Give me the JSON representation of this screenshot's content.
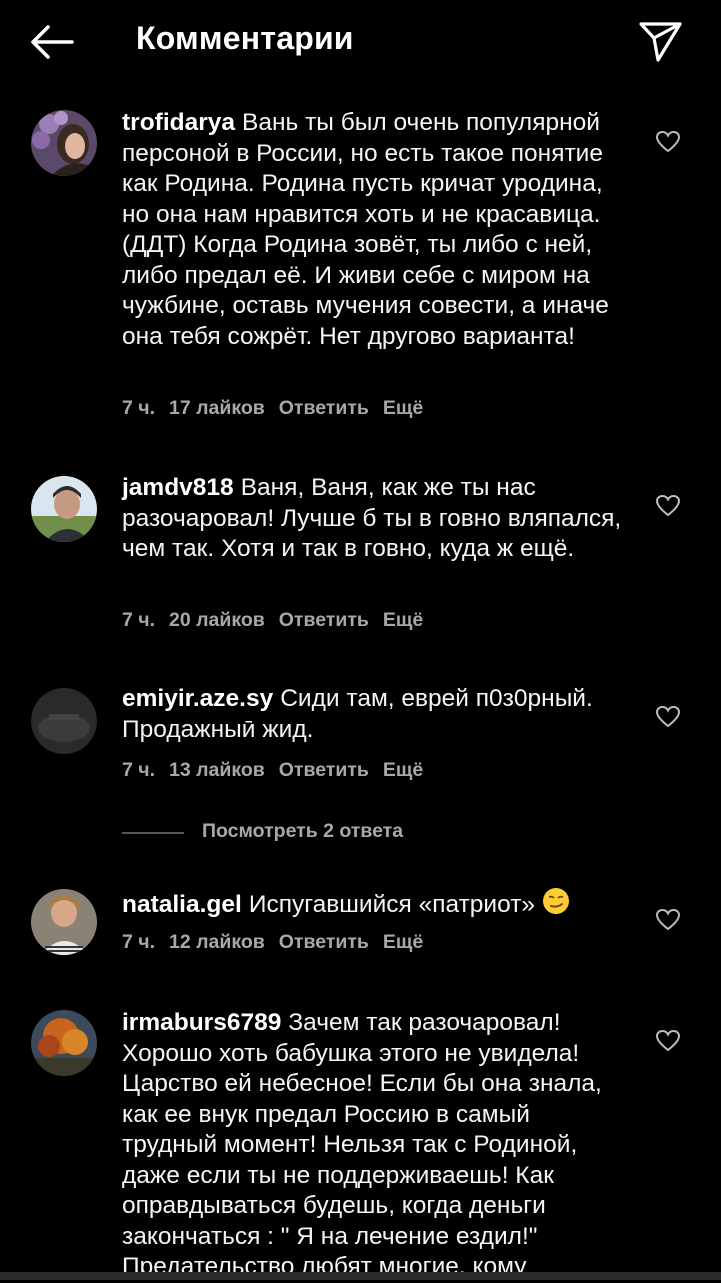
{
  "header": {
    "title": "Комментарии"
  },
  "comments": [
    {
      "username": "trofidarya",
      "text": "Вань ты был очень популярной персоной в России, но есть такое понятие как Родина. Родина пусть кричат уродина, но она нам нравится хоть и не красавица. (ДДТ) Когда Родина зовёт, ты либо с ней, либо предал её. И живи себе с миром на чужбине, оставь мучения совести, а иначе она тебя сожрёт. Нет другово варианта!",
      "time": "7 ч.",
      "likes": "17 лайков",
      "reply": "Ответить",
      "more": "Ещё"
    },
    {
      "username": "jamdv818",
      "text": "Ваня, Ваня, как же ты нас разочаровал! Лучше б ты в говно вляпался, чем так. Хотя и так в говно, куда ж ещё.",
      "time": "7 ч.",
      "likes": "20 лайков",
      "reply": "Ответить",
      "more": "Ещё"
    },
    {
      "username": "emiyir.aze.sy",
      "text": "Сиди там, еврей п0з0рный. Продажныӣ жид.",
      "time": "7 ч.",
      "likes": "13 лайков",
      "reply": "Ответить",
      "more": "Ещё"
    },
    {
      "username": "natalia.gel",
      "text": "Испугавшийся «патриот»",
      "time": "7 ч.",
      "likes": "12 лайков",
      "reply": "Ответить",
      "more": "Ещё"
    },
    {
      "username": "irmaburs6789",
      "text": "Зачем так разочаровал! Хорошо хоть бабушка этого не увидела! Царство ей небесное! Если бы она знала, как ее внук предал Россию в самый трудный момент! Нельзя так с Родиной, даже если ты не поддерживаешь! Как оправдываться будешь, когда деньги закончаться : \" Я на лечение ездил!\" Предательство любят многие, кому"
    }
  ],
  "view_replies": "Посмотреть 2 ответа",
  "icons": {
    "back": "arrow-left-icon",
    "send": "paper-plane-icon",
    "like": "heart-outline-icon",
    "emoji": "smirking-face-emoji"
  }
}
